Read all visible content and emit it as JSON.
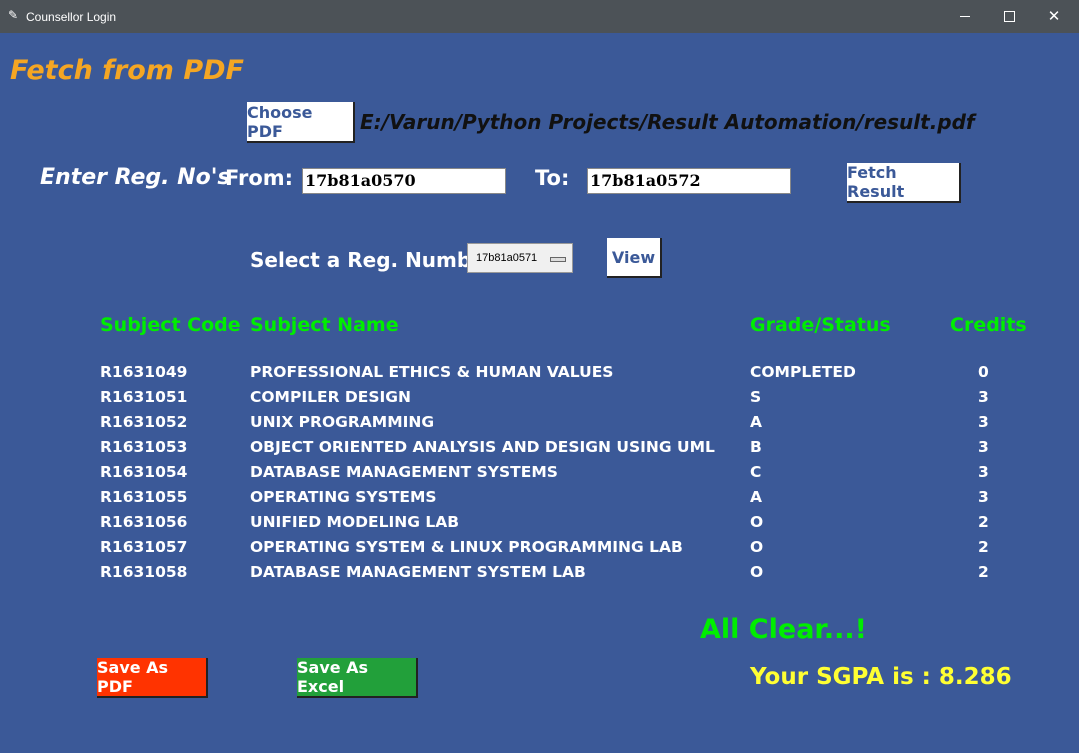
{
  "window": {
    "title": "Counsellor Login",
    "controls": {
      "minimize": "minimize-icon",
      "maximize": "maximize-icon",
      "close": "✕"
    }
  },
  "heading": "Fetch from PDF",
  "file": {
    "choose_label": "Choose PDF",
    "path": "E:/Varun/Python Projects/Result Automation/result.pdf"
  },
  "range": {
    "regno_label": "Enter Reg. No's",
    "from_label": "From:",
    "from_value": "17b81a0570",
    "to_label": "To:",
    "to_value": "17b81a0572",
    "fetch_label": "Fetch Result"
  },
  "select": {
    "label": "Select a Reg. Number",
    "value": "17b81a0571",
    "view_label": "View"
  },
  "table": {
    "headers": [
      "Subject Code",
      "Subject Name",
      "Grade/Status",
      "Credits"
    ],
    "rows": [
      [
        "R1631049",
        "PROFESSIONAL ETHICS & HUMAN VALUES",
        "COMPLETED",
        "0"
      ],
      [
        "R1631051",
        "COMPILER DESIGN",
        "S",
        "3"
      ],
      [
        "R1631052",
        "UNIX PROGRAMMING",
        "A",
        "3"
      ],
      [
        "R1631053",
        "OBJECT ORIENTED ANALYSIS AND DESIGN USING UML",
        "B",
        "3"
      ],
      [
        "R1631054",
        "DATABASE MANAGEMENT SYSTEMS",
        "C",
        "3"
      ],
      [
        "R1631055",
        "OPERATING SYSTEMS",
        "A",
        "3"
      ],
      [
        "R1631056",
        "UNIFIED MODELING LAB",
        "O",
        "2"
      ],
      [
        "R1631057",
        "OPERATING SYSTEM & LINUX PROGRAMMING LAB",
        "O",
        "2"
      ],
      [
        "R1631058",
        "DATABASE MANAGEMENT SYSTEM LAB",
        "O",
        "2"
      ]
    ]
  },
  "result": {
    "status": "All Clear...!",
    "sgpa": "Your SGPA is : 8.286"
  },
  "actions": {
    "save_pdf": "Save As PDF",
    "save_excel": "Save As Excel"
  },
  "colors": {
    "background": "#3b5998",
    "heading": "#f5a623",
    "header_green": "#00ee00",
    "sgpa_yellow": "#ffff33",
    "save_pdf_bg": "#ff3300",
    "save_excel_bg": "#22a03a"
  }
}
